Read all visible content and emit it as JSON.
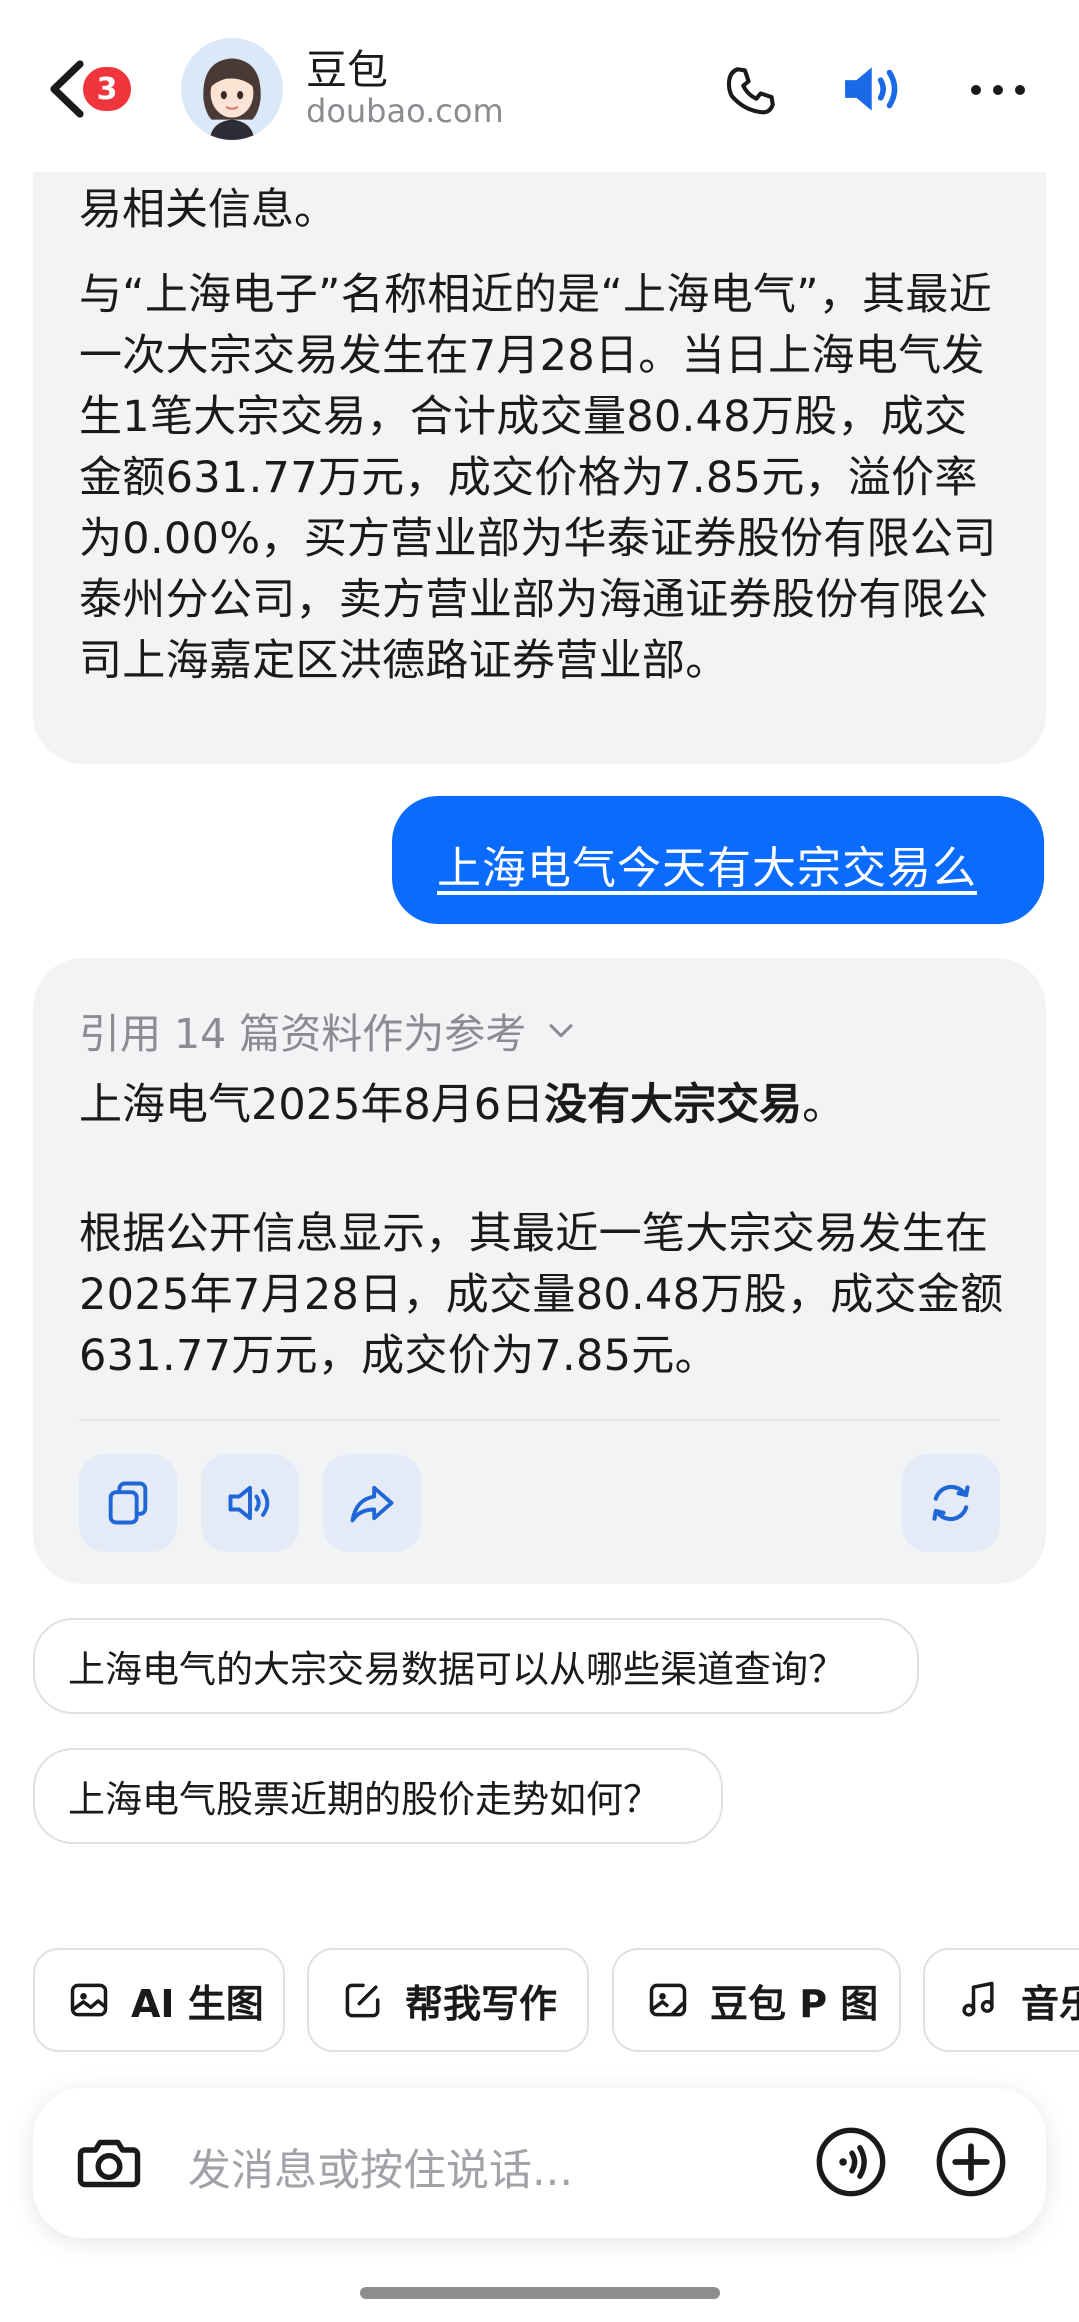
{
  "header": {
    "unread_count": "3",
    "name": "豆包",
    "domain": "doubao.com"
  },
  "messages": {
    "ai_1": {
      "clipped_line": "易相关信息。",
      "text": "与“上海电子”名称相近的是“上海电气”，其最近一次大宗交易发生在7月28日。当日上海电气发生1笔大宗交易，合计成交量80.48万股，成交金额631.77万元，成交价格为7.85元，溢价率为0.00%，买方营业部为华泰证券股份有限公司泰州分公司，卖方营业部为海通证券股份有限公司上海嘉定区洪德路证券营业部。"
    },
    "user_1": {
      "text": "上海电气今天有大宗交易么"
    },
    "ai_2": {
      "references": "引用 14 篇资料作为参考",
      "line1_prefix": "上海电气2025年8月6日",
      "line1_bold": "没有大宗交易",
      "line1_suffix": "。",
      "paragraph": "根据公开信息显示，其最近一笔大宗交易发生在2025年7月28日，成交量80.48万股，成交金额631.77万元，成交价为7.85元。"
    }
  },
  "actions": [
    "copy-icon",
    "speaker-icon",
    "share-icon",
    "regenerate-icon"
  ],
  "suggestions": [
    "上海电气的大宗交易数据可以从哪些渠道查询？",
    "上海电气股票近期的股价走势如何？"
  ],
  "tools": [
    {
      "label": "AI 生图",
      "icon": "image-icon"
    },
    {
      "label": "帮我写作",
      "icon": "edit-icon"
    },
    {
      "label": "豆包 P 图",
      "icon": "photo-edit-icon"
    },
    {
      "label": "音乐",
      "icon": "music-icon"
    }
  ],
  "input": {
    "placeholder": "发消息或按住说话..."
  },
  "colors": {
    "accent": "#0a6bff",
    "badge": "#f0363c",
    "bubble": "#f2f3f5"
  }
}
